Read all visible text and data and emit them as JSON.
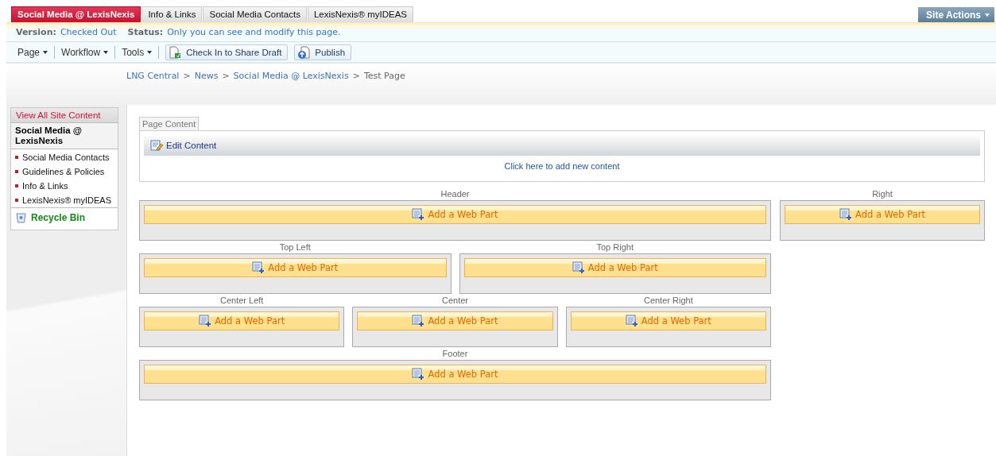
{
  "tabs": [
    {
      "label": "Social Media @ LexisNexis",
      "selected": true
    },
    {
      "label": "Info & Links",
      "selected": false
    },
    {
      "label": "Social Media Contacts",
      "selected": false
    },
    {
      "label": "LexisNexis® myIDEAS",
      "selected": false
    }
  ],
  "site_actions": {
    "label": "Site Actions"
  },
  "status_bar": {
    "version_label": "Version:",
    "version": "Checked Out",
    "status_label": "Status:",
    "status": "Only you can see and modify this page."
  },
  "toolbar": {
    "menus": [
      "Page",
      "Workflow",
      "Tools"
    ],
    "buttons": [
      {
        "kind": "checkin",
        "label": "Check In to Share Draft"
      },
      {
        "kind": "publish",
        "label": "Publish"
      }
    ]
  },
  "breadcrumb": {
    "separator": ">",
    "items": [
      "LNG Central",
      "News",
      "Social Media @ LexisNexis"
    ],
    "current": "Test Page"
  },
  "sidebar": {
    "view_all": "View All Site Content",
    "heading": "Social Media @ LexisNexis",
    "items": [
      "Social Media Contacts",
      "Guidelines & Policies",
      "Info & Links",
      "LexisNexis® myIDEAS"
    ],
    "recycle_bin": "Recycle Bin"
  },
  "page_content": {
    "tab": "Page Content",
    "edit": "Edit Content",
    "add_link": "Click here to add new content"
  },
  "zones": {
    "main_rows": [
      [
        {
          "title": "Header",
          "button": "Add a Web Part"
        }
      ],
      [
        {
          "title": "Top Left",
          "button": "Add a Web Part"
        },
        {
          "title": "Top Right",
          "button": "Add a Web Part"
        }
      ],
      [
        {
          "title": "Center Left",
          "button": "Add a Web Part"
        },
        {
          "title": "Center",
          "button": "Add a Web Part"
        },
        {
          "title": "Center Right",
          "button": "Add a Web Part"
        }
      ],
      [
        {
          "title": "Footer",
          "button": "Add a Web Part"
        }
      ]
    ],
    "right": {
      "title": "Right",
      "button": "Add a Web Part"
    }
  }
}
